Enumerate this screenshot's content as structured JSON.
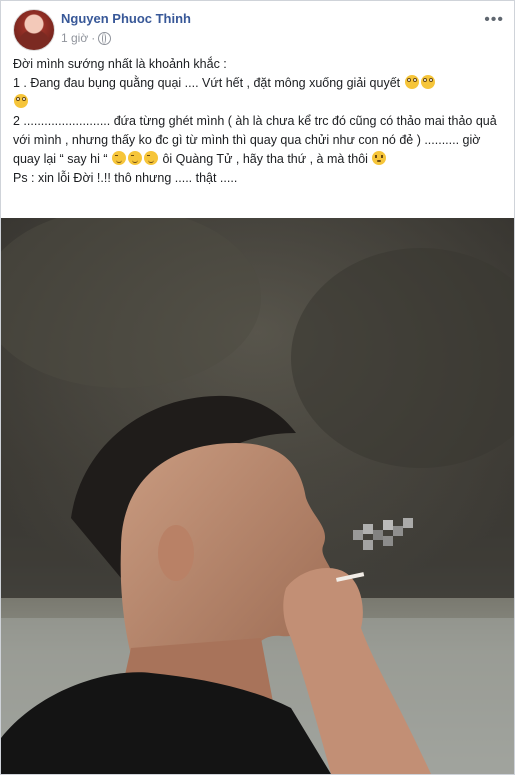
{
  "post": {
    "author": "Nguyen Phuoc Thinh",
    "time": "1 giờ",
    "audience_icon": "globe-icon",
    "more_icon": "more-options-icon",
    "lines": [
      "Đời mình sướng nhất là khoảnh khắc :",
      "1 . Đang đau bụng quằng quại .... Vứt hết , đặt mông xuống giải quyết",
      "2 ......................... đứa từng ghét mình ( àh là chưa kể trc đó cũng có thảo mai thảo quả với mình , nhưng thấy ko đc gì từ mình thì quay qua chửi như con nó đẻ ) .......... giờ quay lại “ say hi “",
      "ôi Quàng Tử , hãy tha thứ , à mà thôi",
      "Ps : xin lỗi Đời !.!! thô nhưng ..... thật ....."
    ]
  },
  "colors": {
    "author": "#385898",
    "meta": "#90949c",
    "text": "#1c1e21",
    "border": "#cfd3d9"
  }
}
